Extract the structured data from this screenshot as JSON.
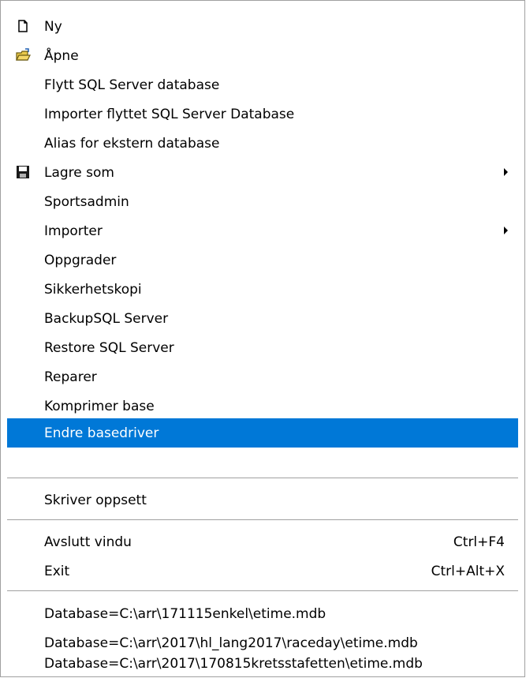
{
  "menu": {
    "items": [
      {
        "label": "Ny",
        "icon": "new-document-icon"
      },
      {
        "label": "Åpne",
        "icon": "open-folder-icon"
      },
      {
        "label": "Flytt SQL Server database"
      },
      {
        "label": "Importer flyttet SQL Server Database"
      },
      {
        "label": "Alias for ekstern database"
      },
      {
        "label": "Lagre som",
        "icon": "floppy-disk-icon",
        "submenu": true
      },
      {
        "label": "Sportsadmin"
      },
      {
        "label": "Importer",
        "submenu": true
      },
      {
        "label": "Oppgrader"
      },
      {
        "label": "Sikkerhetskopi"
      },
      {
        "label": "BackupSQL Server"
      },
      {
        "label": "Restore SQL Server"
      },
      {
        "label": "Reparer"
      },
      {
        "label": "Komprimer base"
      },
      {
        "label": "Endre basedriver",
        "highlighted": true
      },
      {
        "label": "Skriver oppsett"
      },
      {
        "label": "Avslutt vindu",
        "shortcut": "Ctrl+F4"
      },
      {
        "label": "Exit",
        "shortcut": "Ctrl+Alt+X"
      },
      {
        "label": "Database=C:\\arr\\171115enkel\\etime.mdb"
      },
      {
        "label": "Database=C:\\arr\\2017\\hl_lang2017\\raceday\\etime.mdb"
      },
      {
        "label": "Database=C:\\arr\\2017\\170815kretsstafetten\\etime.mdb"
      }
    ]
  },
  "colors": {
    "highlight": "#0078d7",
    "separator": "#a0a0a0"
  }
}
